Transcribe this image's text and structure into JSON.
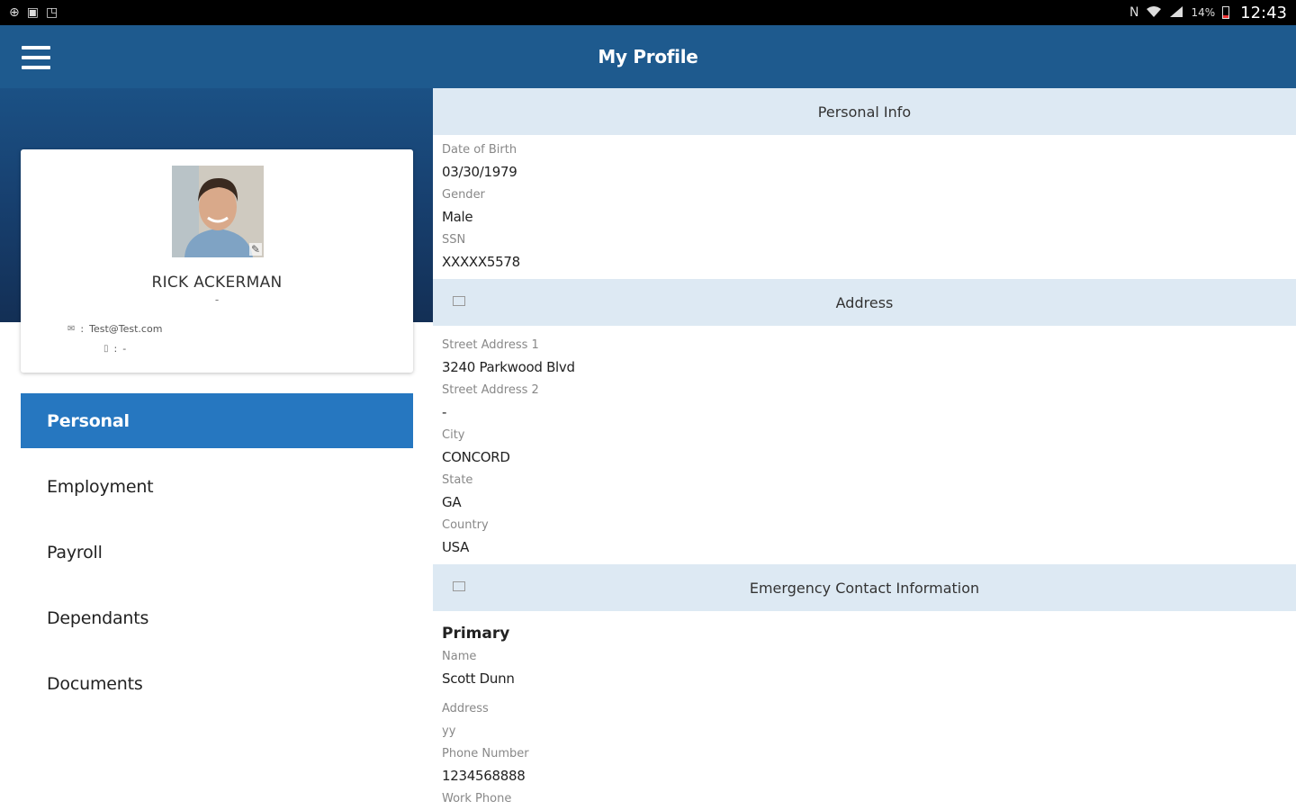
{
  "status_bar": {
    "left_icons": [
      "notification-icon",
      "message-icon",
      "screenshot-icon"
    ],
    "right_icons": [
      "nfc-icon",
      "wifi-icon",
      "signal-icon",
      "battery-icon"
    ],
    "battery": "14%",
    "time": "12:43"
  },
  "app_bar": {
    "title": "My Profile"
  },
  "profile": {
    "name": "RICK ACKERMAN",
    "subtitle": "-",
    "email_sep": ":",
    "email": "Test@Test.com",
    "phone_sep": ":",
    "phone": "-"
  },
  "nav": {
    "items": [
      {
        "label": "Personal",
        "active": true
      },
      {
        "label": "Employment",
        "active": false
      },
      {
        "label": "Payroll",
        "active": false
      },
      {
        "label": "Dependants",
        "active": false
      },
      {
        "label": "Documents",
        "active": false
      }
    ]
  },
  "personal_info": {
    "heading": "Personal Info",
    "dob_label": "Date of Birth",
    "dob_value": "03/30/1979",
    "gender_label": "Gender",
    "gender_value": "Male",
    "ssn_label": "SSN",
    "ssn_value": "XXXXX5578"
  },
  "address": {
    "heading": "Address",
    "street1_label": "Street Address 1",
    "street1_value": "3240 Parkwood Blvd",
    "street2_label": "Street Address 2",
    "street2_value": "-",
    "city_label": "City",
    "city_value": "CONCORD",
    "state_label": "State",
    "state_value": "GA",
    "country_label": "Country",
    "country_value": "USA"
  },
  "emergency": {
    "heading": "Emergency Contact Information",
    "primary_label": "Primary",
    "name_label": "Name",
    "name_value": "Scott Dunn",
    "address_label": "Address",
    "address_value": "yy",
    "phone_label": "Phone Number",
    "phone_value": "1234568888",
    "work_phone_label": "Work Phone",
    "work_phone_value": "-"
  },
  "colors": {
    "app_bar": "#1e5a8e",
    "nav_active": "#2677c0",
    "section_head": "#dde9f3"
  }
}
